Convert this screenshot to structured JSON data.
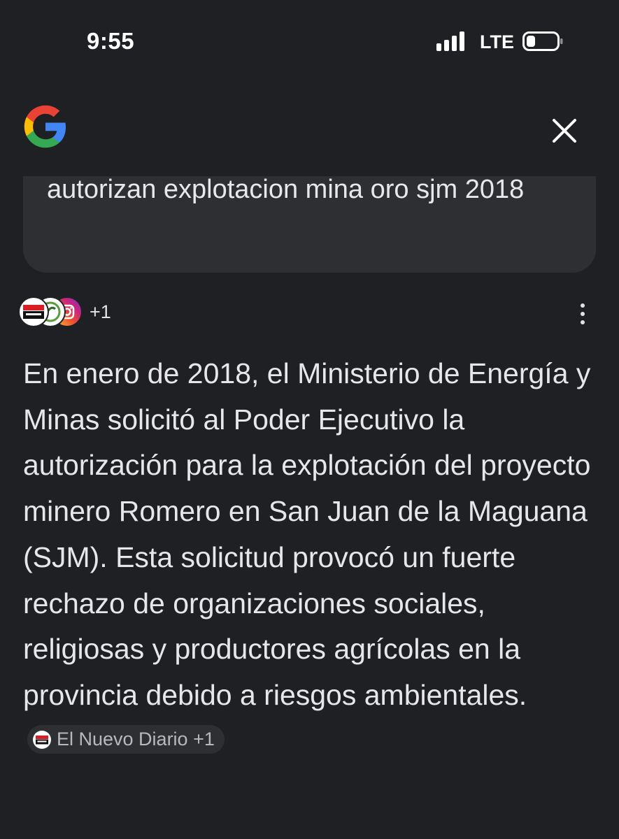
{
  "status_bar": {
    "time": "9:55",
    "network": "LTE",
    "signal_bars": 4,
    "battery_level": 0.2
  },
  "header": {
    "logo": "google-logo",
    "close_icon": "close-icon"
  },
  "query": {
    "text": "autorizan explotacion mina oro sjm 2018"
  },
  "sources": {
    "icons": [
      "el-nuevo-diario-logo",
      "source-logo",
      "instagram-icon"
    ],
    "extra_count": "+1",
    "menu_icon": "more-vert-icon"
  },
  "answer": {
    "text": "En enero de 2018, el Ministerio de Energía y Minas solicitó al Poder Ejecutivo la autorización para la explotación del proyecto minero Romero en San Juan de la Maguana (SJM). Esta solicitud provocó un fuerte rechazo de organizaciones sociales, religiosas y productores agrícolas en la provincia debido a riesgos ambientales.",
    "citation": {
      "label": "El Nuevo Diario +1",
      "logo_text": "El Nuevo Diario"
    }
  },
  "colors": {
    "background": "#1f2023",
    "card": "#2e2f33",
    "text": "#e7e7ea",
    "muted_text": "#b8b9be"
  }
}
